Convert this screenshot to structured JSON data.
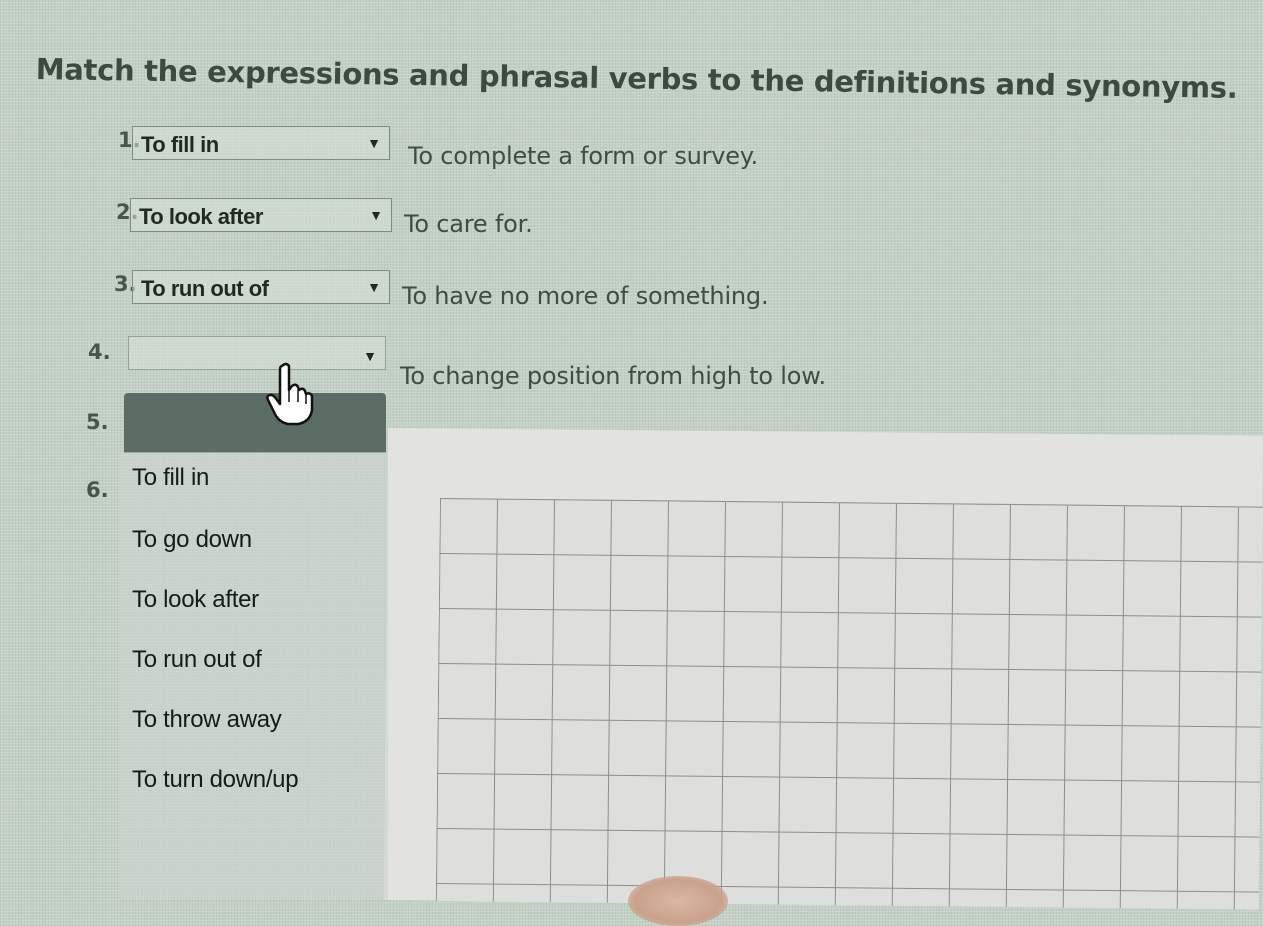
{
  "exercise": {
    "instruction": "Match the expressions and phrasal verbs to the definitions and synonyms.",
    "items": [
      {
        "number": "1.",
        "selected": "To fill in",
        "definition": "To complete a form or survey."
      },
      {
        "number": "2.",
        "selected": "To look after",
        "definition": "To care for."
      },
      {
        "number": "3.",
        "selected": "To run out of",
        "definition": "To have no more of something."
      },
      {
        "number": "4.",
        "selected": "",
        "definition": "To change position from high to low."
      },
      {
        "number": "5."
      },
      {
        "number": "6."
      }
    ]
  },
  "dropdown": {
    "icon": "chevron-down-icon",
    "options": [
      "To fill in",
      "To go down",
      "To look after",
      "To run out of",
      "To throw away",
      "To turn down/up"
    ]
  },
  "cursor": {
    "icon": "hand-pointer-icon"
  },
  "colors": {
    "background": "#c3d0c5",
    "text": "#3f4d43",
    "highlight": "#5a6c64",
    "grid_paper": "#dedfdc"
  }
}
